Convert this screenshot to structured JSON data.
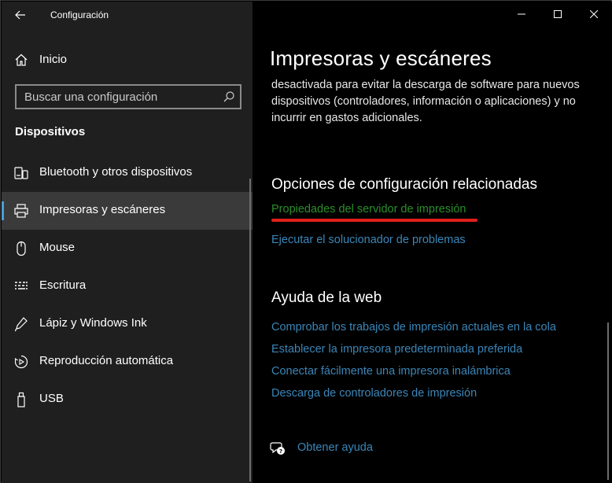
{
  "window": {
    "title": "Configuración"
  },
  "sidebar": {
    "home_label": "Inicio",
    "search_placeholder": "Buscar una configuración",
    "section_title": "Dispositivos",
    "items": [
      {
        "label": "Bluetooth y otros dispositivos",
        "icon": "bluetooth-icon"
      },
      {
        "label": "Impresoras y escáneres",
        "icon": "printer-icon",
        "active": true
      },
      {
        "label": "Mouse",
        "icon": "mouse-icon"
      },
      {
        "label": "Escritura",
        "icon": "keyboard-icon"
      },
      {
        "label": "Lápiz y Windows Ink",
        "icon": "pen-icon"
      },
      {
        "label": "Reproducción automática",
        "icon": "autoplay-icon"
      },
      {
        "label": "USB",
        "icon": "usb-icon"
      }
    ]
  },
  "main": {
    "title": "Impresoras y escáneres",
    "description": "desactivada para evitar la descarga de software para nuevos dispositivos (controladores, información o aplicaciones) y no incurrir en gastos adicionales.",
    "related_heading": "Opciones de configuración relacionadas",
    "related_links": [
      "Propiedades del servidor de impresión",
      "Ejecutar el solucionador de problemas"
    ],
    "web_heading": "Ayuda de la web",
    "web_links": [
      "Comprobar los trabajos de impresión actuales en la cola",
      "Establecer la impresora predeterminada preferida",
      "Conectar fácilmente una impresora inalámbrica",
      "Descarga de controladores de impresión"
    ],
    "get_help": "Obtener ayuda"
  },
  "colors": {
    "accent": "#4aa0d8",
    "link": "#3b86b8",
    "highlighted_link": "#2a8f2a",
    "annotation_underline": "#e0201a"
  }
}
